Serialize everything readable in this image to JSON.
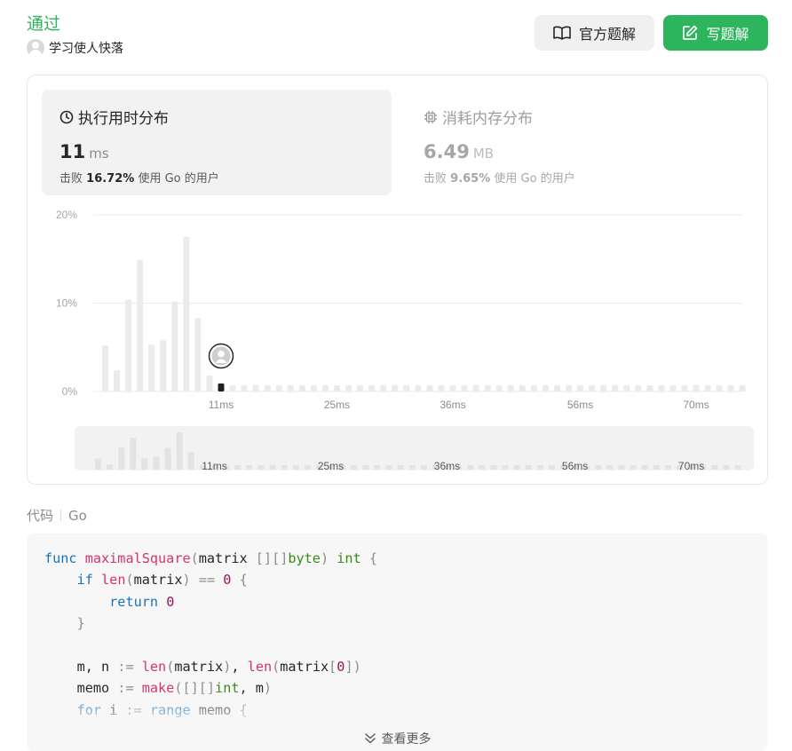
{
  "header": {
    "status": "通过",
    "author": "学习使人快落",
    "official_button": "官方题解",
    "write_button": "写题解",
    "official_icon": "book-open-icon",
    "write_icon": "edit-icon"
  },
  "runtime": {
    "title": "执行用时分布",
    "icon": "clock-icon",
    "value": "11",
    "unit": "ms",
    "beat_prefix": "击败",
    "beat_percent": "16.72%",
    "beat_suffix": "使用 Go 的用户"
  },
  "memory": {
    "title": "消耗内存分布",
    "icon": "chip-icon",
    "value": "6.49",
    "unit": "MB",
    "beat_prefix": "击败",
    "beat_percent": "9.65%",
    "beat_suffix": "使用 Go 的用户"
  },
  "chart_data": {
    "type": "bar",
    "ylabel": "",
    "xlabel": "",
    "ylim": [
      0,
      20
    ],
    "y_ticks": [
      "20%",
      "10%",
      "0%"
    ],
    "y_tick_values": [
      20,
      10,
      0
    ],
    "x_tick_labels": [
      "11ms",
      "25ms",
      "36ms",
      "56ms",
      "70ms"
    ],
    "x_tick_bar_index": [
      10,
      20,
      30,
      41,
      51
    ],
    "values": [
      5.2,
      2.4,
      10.4,
      14.9,
      5.3,
      5.8,
      10.2,
      17.5,
      8.3,
      1.8,
      0.9,
      0.7,
      0.7,
      0.7,
      0.7,
      0.7,
      0.7,
      0.7,
      0.7,
      0.7,
      0.7,
      0.7,
      0.7,
      0.7,
      0.7,
      0.7,
      0.7,
      0.7,
      0.7,
      0.7,
      0.7,
      0.7,
      0.7,
      0.7,
      0.7,
      0.7,
      0.7,
      0.7,
      0.7,
      0.7,
      0.7,
      0.7,
      0.7,
      0.7,
      0.7,
      0.7,
      0.7,
      0.7,
      0.7,
      0.7,
      0.7,
      0.7,
      0.7,
      0.7,
      0.7,
      0.7
    ],
    "highlight_index": 10,
    "highlight_value": 0.9,
    "colors": {
      "bar": "#ebebeb",
      "highlight": "#1f1f1f",
      "grid": "#ebebeb",
      "overview_bg": "#f2f2f2",
      "overview_bar": "#e3e3e3"
    }
  },
  "code_section": {
    "label": "代码",
    "language": "Go",
    "more": "查看更多",
    "more_icon": "double-chevron-down-icon"
  }
}
